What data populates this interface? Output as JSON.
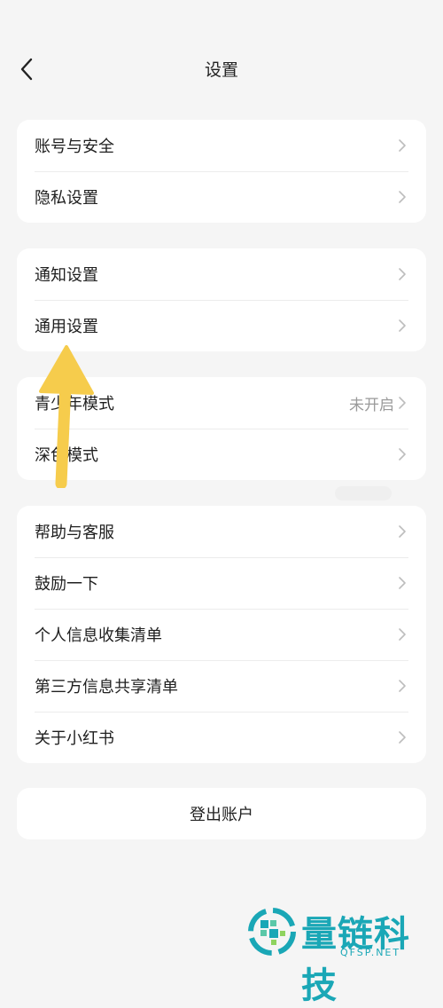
{
  "header": {
    "title": "设置"
  },
  "groups": [
    {
      "items": [
        {
          "label": "账号与安全"
        },
        {
          "label": "隐私设置"
        }
      ]
    },
    {
      "items": [
        {
          "label": "通知设置"
        },
        {
          "label": "通用设置"
        }
      ]
    },
    {
      "items": [
        {
          "label": "青少年模式",
          "value": "未开启"
        },
        {
          "label": "深色模式"
        }
      ]
    },
    {
      "items": [
        {
          "label": "帮助与客服"
        },
        {
          "label": "鼓励一下"
        },
        {
          "label": "个人信息收集清单"
        },
        {
          "label": "第三方信息共享清单"
        },
        {
          "label": "关于小红书"
        }
      ]
    }
  ],
  "logout": {
    "label": "登出账户"
  },
  "annotation": {
    "arrow_color": "#f6cc4c",
    "target": "通用设置"
  },
  "watermark": {
    "brand": "量链科技",
    "url": "QFSP.NET",
    "color": "#1aa7b6"
  },
  "icons": {
    "back": "chevron-left-icon",
    "row": "chevron-right-icon"
  }
}
